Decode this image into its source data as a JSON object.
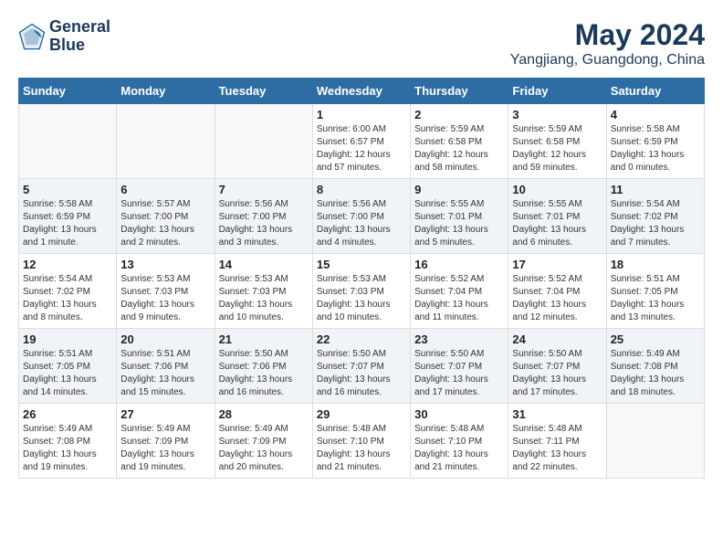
{
  "header": {
    "logo_line1": "General",
    "logo_line2": "Blue",
    "month": "May 2024",
    "location": "Yangjiang, Guangdong, China"
  },
  "weekdays": [
    "Sunday",
    "Monday",
    "Tuesday",
    "Wednesday",
    "Thursday",
    "Friday",
    "Saturday"
  ],
  "weeks": [
    [
      {
        "day": "",
        "info": ""
      },
      {
        "day": "",
        "info": ""
      },
      {
        "day": "",
        "info": ""
      },
      {
        "day": "1",
        "info": "Sunrise: 6:00 AM\nSunset: 6:57 PM\nDaylight: 12 hours and 57 minutes."
      },
      {
        "day": "2",
        "info": "Sunrise: 5:59 AM\nSunset: 6:58 PM\nDaylight: 12 hours and 58 minutes."
      },
      {
        "day": "3",
        "info": "Sunrise: 5:59 AM\nSunset: 6:58 PM\nDaylight: 12 hours and 59 minutes."
      },
      {
        "day": "4",
        "info": "Sunrise: 5:58 AM\nSunset: 6:59 PM\nDaylight: 13 hours and 0 minutes."
      }
    ],
    [
      {
        "day": "5",
        "info": "Sunrise: 5:58 AM\nSunset: 6:59 PM\nDaylight: 13 hours and 1 minute."
      },
      {
        "day": "6",
        "info": "Sunrise: 5:57 AM\nSunset: 7:00 PM\nDaylight: 13 hours and 2 minutes."
      },
      {
        "day": "7",
        "info": "Sunrise: 5:56 AM\nSunset: 7:00 PM\nDaylight: 13 hours and 3 minutes."
      },
      {
        "day": "8",
        "info": "Sunrise: 5:56 AM\nSunset: 7:00 PM\nDaylight: 13 hours and 4 minutes."
      },
      {
        "day": "9",
        "info": "Sunrise: 5:55 AM\nSunset: 7:01 PM\nDaylight: 13 hours and 5 minutes."
      },
      {
        "day": "10",
        "info": "Sunrise: 5:55 AM\nSunset: 7:01 PM\nDaylight: 13 hours and 6 minutes."
      },
      {
        "day": "11",
        "info": "Sunrise: 5:54 AM\nSunset: 7:02 PM\nDaylight: 13 hours and 7 minutes."
      }
    ],
    [
      {
        "day": "12",
        "info": "Sunrise: 5:54 AM\nSunset: 7:02 PM\nDaylight: 13 hours and 8 minutes."
      },
      {
        "day": "13",
        "info": "Sunrise: 5:53 AM\nSunset: 7:03 PM\nDaylight: 13 hours and 9 minutes."
      },
      {
        "day": "14",
        "info": "Sunrise: 5:53 AM\nSunset: 7:03 PM\nDaylight: 13 hours and 10 minutes."
      },
      {
        "day": "15",
        "info": "Sunrise: 5:53 AM\nSunset: 7:03 PM\nDaylight: 13 hours and 10 minutes."
      },
      {
        "day": "16",
        "info": "Sunrise: 5:52 AM\nSunset: 7:04 PM\nDaylight: 13 hours and 11 minutes."
      },
      {
        "day": "17",
        "info": "Sunrise: 5:52 AM\nSunset: 7:04 PM\nDaylight: 13 hours and 12 minutes."
      },
      {
        "day": "18",
        "info": "Sunrise: 5:51 AM\nSunset: 7:05 PM\nDaylight: 13 hours and 13 minutes."
      }
    ],
    [
      {
        "day": "19",
        "info": "Sunrise: 5:51 AM\nSunset: 7:05 PM\nDaylight: 13 hours and 14 minutes."
      },
      {
        "day": "20",
        "info": "Sunrise: 5:51 AM\nSunset: 7:06 PM\nDaylight: 13 hours and 15 minutes."
      },
      {
        "day": "21",
        "info": "Sunrise: 5:50 AM\nSunset: 7:06 PM\nDaylight: 13 hours and 16 minutes."
      },
      {
        "day": "22",
        "info": "Sunrise: 5:50 AM\nSunset: 7:07 PM\nDaylight: 13 hours and 16 minutes."
      },
      {
        "day": "23",
        "info": "Sunrise: 5:50 AM\nSunset: 7:07 PM\nDaylight: 13 hours and 17 minutes."
      },
      {
        "day": "24",
        "info": "Sunrise: 5:50 AM\nSunset: 7:07 PM\nDaylight: 13 hours and 17 minutes."
      },
      {
        "day": "25",
        "info": "Sunrise: 5:49 AM\nSunset: 7:08 PM\nDaylight: 13 hours and 18 minutes."
      }
    ],
    [
      {
        "day": "26",
        "info": "Sunrise: 5:49 AM\nSunset: 7:08 PM\nDaylight: 13 hours and 19 minutes."
      },
      {
        "day": "27",
        "info": "Sunrise: 5:49 AM\nSunset: 7:09 PM\nDaylight: 13 hours and 19 minutes."
      },
      {
        "day": "28",
        "info": "Sunrise: 5:49 AM\nSunset: 7:09 PM\nDaylight: 13 hours and 20 minutes."
      },
      {
        "day": "29",
        "info": "Sunrise: 5:48 AM\nSunset: 7:10 PM\nDaylight: 13 hours and 21 minutes."
      },
      {
        "day": "30",
        "info": "Sunrise: 5:48 AM\nSunset: 7:10 PM\nDaylight: 13 hours and 21 minutes."
      },
      {
        "day": "31",
        "info": "Sunrise: 5:48 AM\nSunset: 7:11 PM\nDaylight: 13 hours and 22 minutes."
      },
      {
        "day": "",
        "info": ""
      }
    ]
  ]
}
